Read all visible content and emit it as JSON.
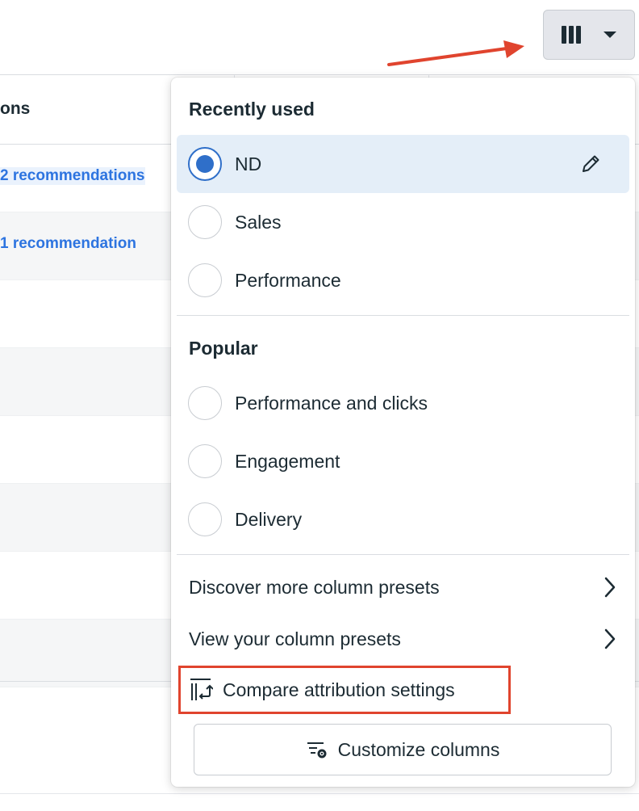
{
  "header": {
    "columns_button": {
      "icon": "columns-icon",
      "dropdown_icon": "caret-down-icon"
    }
  },
  "table": {
    "header_fragment": "ons",
    "rows": [
      {
        "link": "2 recommendations"
      },
      {
        "link": "1 recommendation"
      },
      {
        "link": ""
      },
      {
        "link": ""
      },
      {
        "link": ""
      },
      {
        "link": ""
      },
      {
        "link": ""
      },
      {
        "link": ""
      }
    ]
  },
  "menu": {
    "recently_used": {
      "title": "Recently used",
      "items": [
        {
          "label": "ND",
          "selected": true,
          "edit_icon": "pencil-icon"
        },
        {
          "label": "Sales",
          "selected": false
        },
        {
          "label": "Performance",
          "selected": false
        }
      ]
    },
    "popular": {
      "title": "Popular",
      "items": [
        {
          "label": "Performance and clicks",
          "selected": false
        },
        {
          "label": "Engagement",
          "selected": false
        },
        {
          "label": "Delivery",
          "selected": false
        }
      ]
    },
    "links": {
      "discover": "Discover more column presets",
      "view": "View your column presets",
      "compare": "Compare attribution settings",
      "customize": "Customize columns"
    },
    "icons": {
      "chevron": "chevron-right-icon",
      "compare": "compare-attribution-icon",
      "customize": "customize-columns-icon"
    }
  },
  "colors": {
    "accent": "#2f6fc9",
    "link": "#2d74e0",
    "selected_bg": "#e4eef8",
    "highlight": "#e0442e"
  }
}
